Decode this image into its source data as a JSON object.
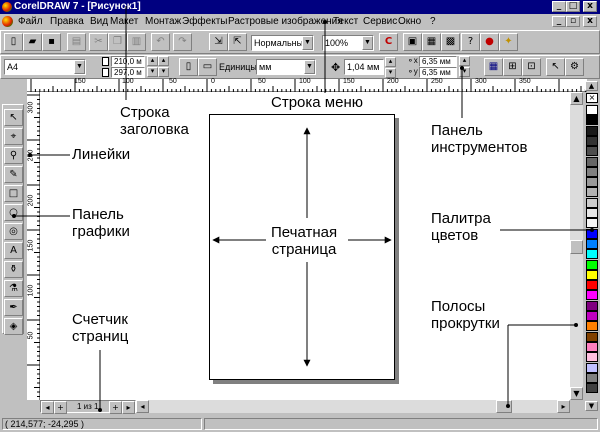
{
  "window": {
    "title": "CorelDRAW 7 - [Рисунок1]",
    "minimize": "_",
    "maximize": "□",
    "close": "x"
  },
  "menu": {
    "items": [
      "Файл",
      "Правка",
      "Вид",
      "Макет",
      "Монтаж",
      "Эффекты",
      "Растровые изображения",
      "Текст",
      "Сервис",
      "Окно",
      "?"
    ]
  },
  "toolbar1": {
    "style_select": "Нормальный",
    "zoom_select": "100%"
  },
  "toolbar2": {
    "paper_size": "A4",
    "width_value": "210,0 м",
    "height_value": "297,0 м",
    "units_label": "Единицы:",
    "units_value": "мм",
    "nudge_value": "1,04 мм",
    "dup_x": "6,35 мм",
    "dup_y": "6,35 мм"
  },
  "rulers": {
    "h_ticks": [
      "150",
      "100",
      "50",
      "0",
      "50",
      "100",
      "150",
      "200",
      "250",
      "300",
      "350"
    ],
    "v_ticks": [
      "300",
      "250",
      "200",
      "150",
      "100",
      "50"
    ]
  },
  "page_counter": {
    "label": "1 из 1"
  },
  "status": {
    "coordinates": "( 214,577; -24,295 )"
  },
  "palette": {
    "colors": [
      "#ffffff",
      "#000000",
      "#1a1a1a",
      "#333333",
      "#4d4d4d",
      "#666666",
      "#808080",
      "#999999",
      "#b3b3b3",
      "#cccccc",
      "#e6e6e6",
      "#f5f5f5",
      "#0000ff",
      "#0080ff",
      "#00ffff",
      "#00ff00",
      "#ffff00",
      "#ff0000",
      "#ff00ff",
      "#800080",
      "#c000c0",
      "#ff8000",
      "#804000",
      "#ff80c0",
      "#ffc0e0",
      "#c0c0ff",
      "#808080",
      "#404040"
    ]
  },
  "annotations": {
    "title_bar": "Строка\nзаголовка",
    "menu_bar": "Строка меню",
    "rulers": "Линейки",
    "toolbar": "Панель\nинструментов",
    "graphics_panel": "Панель\nграфики",
    "color_palette": "Палитра\nцветов",
    "printed_page": "Печатная\nстраница",
    "page_counter": "Счетчик\nстраниц",
    "scrollbars": "Полосы\nпрокрутки"
  }
}
